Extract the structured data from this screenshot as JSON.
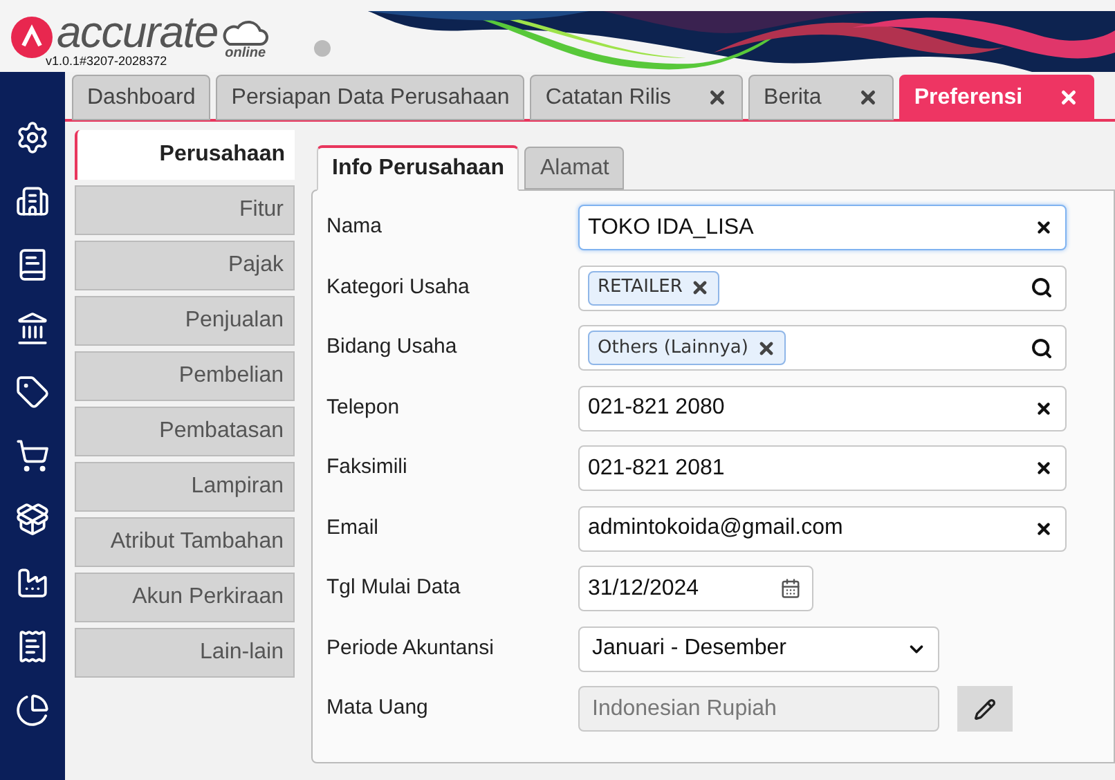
{
  "brand": {
    "name": "accurate",
    "edition": "online",
    "version": "v1.0.1#3207-2028372"
  },
  "tabs": [
    {
      "label": "Dashboard",
      "closable": false,
      "selected": false
    },
    {
      "label": "Persiapan Data Perusahaan",
      "closable": false,
      "selected": false
    },
    {
      "label": "Catatan Rilis",
      "closable": true,
      "selected": false
    },
    {
      "label": "Berita",
      "closable": true,
      "selected": false
    },
    {
      "label": "Preferensi",
      "closable": true,
      "selected": true
    }
  ],
  "settings_nav": [
    {
      "label": "Perusahaan",
      "selected": true
    },
    {
      "label": "Fitur",
      "selected": false
    },
    {
      "label": "Pajak",
      "selected": false
    },
    {
      "label": "Penjualan",
      "selected": false
    },
    {
      "label": "Pembelian",
      "selected": false
    },
    {
      "label": "Pembatasan",
      "selected": false
    },
    {
      "label": "Lampiran",
      "selected": false
    },
    {
      "label": "Atribut Tambahan",
      "selected": false
    },
    {
      "label": "Akun Perkiraan",
      "selected": false
    },
    {
      "label": "Lain-lain",
      "selected": false
    }
  ],
  "sub_tabs": [
    {
      "label": "Info Perusahaan",
      "selected": true
    },
    {
      "label": "Alamat",
      "selected": false
    }
  ],
  "fields": [
    {
      "label": "Nama",
      "kind": "text",
      "value": "TOKO IDA_LISA",
      "focused": true
    },
    {
      "label": "Kategori Usaha",
      "kind": "tags",
      "tags": [
        "RETAILER"
      ]
    },
    {
      "label": "Bidang Usaha",
      "kind": "tags",
      "tags": [
        "Others (Lainnya)"
      ]
    },
    {
      "label": "Telepon",
      "kind": "text",
      "value": "021-821 2080",
      "focused": false
    },
    {
      "label": "Faksimili",
      "kind": "text",
      "value": "021-821 2081",
      "focused": false
    },
    {
      "label": "Email",
      "kind": "text",
      "value": "admintokoida@gmail.com",
      "focused": false
    },
    {
      "label": "Tgl Mulai Data",
      "kind": "date",
      "value": "31/12/2024"
    },
    {
      "label": "Periode Akuntansi",
      "kind": "select",
      "value": "Januari - Desember"
    },
    {
      "label": "Mata Uang",
      "kind": "readonly",
      "value": "Indonesian Rupiah"
    }
  ]
}
